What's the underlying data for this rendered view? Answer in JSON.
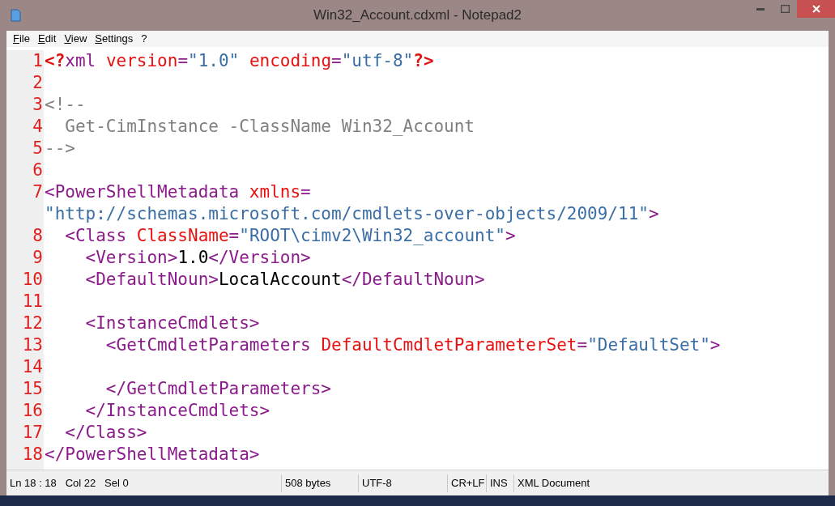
{
  "window": {
    "title": "Win32_Account.cdxml - Notepad2"
  },
  "menu": [
    {
      "label": "File"
    },
    {
      "label": "Edit"
    },
    {
      "label": "View"
    },
    {
      "label": "Settings"
    },
    {
      "label": "?"
    }
  ],
  "lines": [
    {
      "number": "1",
      "tokens": [
        {
          "kind": "pi",
          "text": "<?"
        },
        {
          "kind": "tag",
          "text": "xml"
        },
        {
          "kind": "attr",
          "text": " version"
        },
        {
          "kind": "tag",
          "text": "="
        },
        {
          "kind": "value",
          "text": "\"1.0\""
        },
        {
          "kind": "attr",
          "text": " encoding"
        },
        {
          "kind": "tag",
          "text": "="
        },
        {
          "kind": "value",
          "text": "\"utf-8\""
        },
        {
          "kind": "pi",
          "text": "?>"
        }
      ]
    },
    {
      "number": "2"
    },
    {
      "number": "3",
      "tokens": [
        {
          "kind": "comment",
          "text": "<!--"
        }
      ]
    },
    {
      "number": "4",
      "tokens": [
        {
          "kind": "comment",
          "text": "  Get-CimInstance -ClassName Win32_Account"
        }
      ]
    },
    {
      "number": "5",
      "tokens": [
        {
          "kind": "comment",
          "text": "-->"
        }
      ]
    },
    {
      "number": "6"
    },
    {
      "number": "7",
      "tokens": [
        {
          "kind": "tag",
          "text": "<PowerShellMetadata"
        },
        {
          "kind": "attr",
          "text": " xmlns"
        },
        {
          "kind": "tag",
          "text": "="
        }
      ]
    },
    {
      "tokens": [
        {
          "kind": "value",
          "text": "\"http://schemas.microsoft.com/cmdlets-over-objects/2009/11\""
        },
        {
          "kind": "tag",
          "text": ">"
        }
      ]
    },
    {
      "number": "8",
      "tokens": [
        {
          "kind": "tag",
          "text": "  <Class"
        },
        {
          "kind": "attr",
          "text": " ClassName"
        },
        {
          "kind": "tag",
          "text": "="
        },
        {
          "kind": "value",
          "text": "\"ROOT\\cimv2\\Win32_account\""
        },
        {
          "kind": "tag",
          "text": ">"
        }
      ]
    },
    {
      "number": "9",
      "tokens": [
        {
          "kind": "tag",
          "text": "    <Version>"
        },
        {
          "kind": "text",
          "text": "1.0"
        },
        {
          "kind": "tag",
          "text": "</Version>"
        }
      ]
    },
    {
      "number": "10",
      "tokens": [
        {
          "kind": "tag",
          "text": "    <DefaultNoun>"
        },
        {
          "kind": "text",
          "text": "LocalAccount"
        },
        {
          "kind": "tag",
          "text": "</DefaultNoun>"
        }
      ]
    },
    {
      "number": "11"
    },
    {
      "number": "12",
      "tokens": [
        {
          "kind": "tag",
          "text": "    <InstanceCmdlets>"
        }
      ]
    },
    {
      "number": "13",
      "tokens": [
        {
          "kind": "tag",
          "text": "      <GetCmdletParameters"
        },
        {
          "kind": "attr",
          "text": " DefaultCmdletParameterSet"
        },
        {
          "kind": "tag",
          "text": "="
        },
        {
          "kind": "value",
          "text": "\"DefaultSet\""
        },
        {
          "kind": "tag",
          "text": ">"
        }
      ]
    },
    {
      "number": "14"
    },
    {
      "number": "15",
      "tokens": [
        {
          "kind": "tag",
          "text": "      </GetCmdletParameters>"
        }
      ]
    },
    {
      "number": "16",
      "tokens": [
        {
          "kind": "tag",
          "text": "    </InstanceCmdlets>"
        }
      ]
    },
    {
      "number": "17",
      "tokens": [
        {
          "kind": "tag",
          "text": "  </Class>"
        }
      ]
    },
    {
      "number": "18",
      "tokens": [
        {
          "kind": "tag",
          "text": "</PowerShellMetadata>"
        }
      ]
    }
  ],
  "status_bar": [
    "Ln 18 : 18   Col 22   Sel 0",
    "508 bytes",
    "UTF-8",
    "CR+LF",
    "INS",
    "XML Document"
  ]
}
